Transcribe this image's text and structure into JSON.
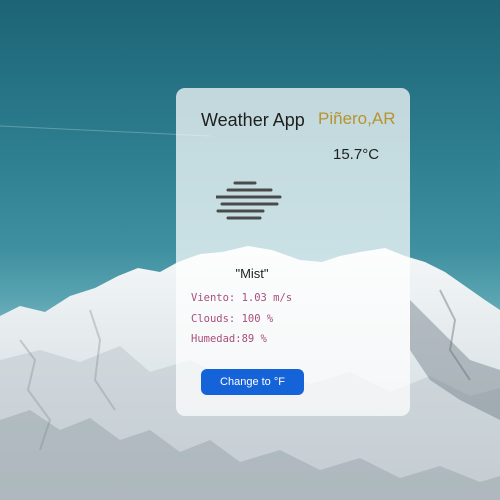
{
  "app": {
    "title": "Weather App",
    "location": "Piñero,AR",
    "temperature": "15.7°C",
    "description": "\"Mist\"",
    "icon": "mist-icon"
  },
  "stats": {
    "wind": "Viento: 1.03 m/s",
    "clouds": "Clouds: 100 %",
    "humidity": "Humedad:89 %"
  },
  "button": {
    "label": "Change to °F",
    "color": "#1563d8"
  },
  "colors": {
    "location": "#b8932f",
    "stats": "#a94f7d"
  }
}
